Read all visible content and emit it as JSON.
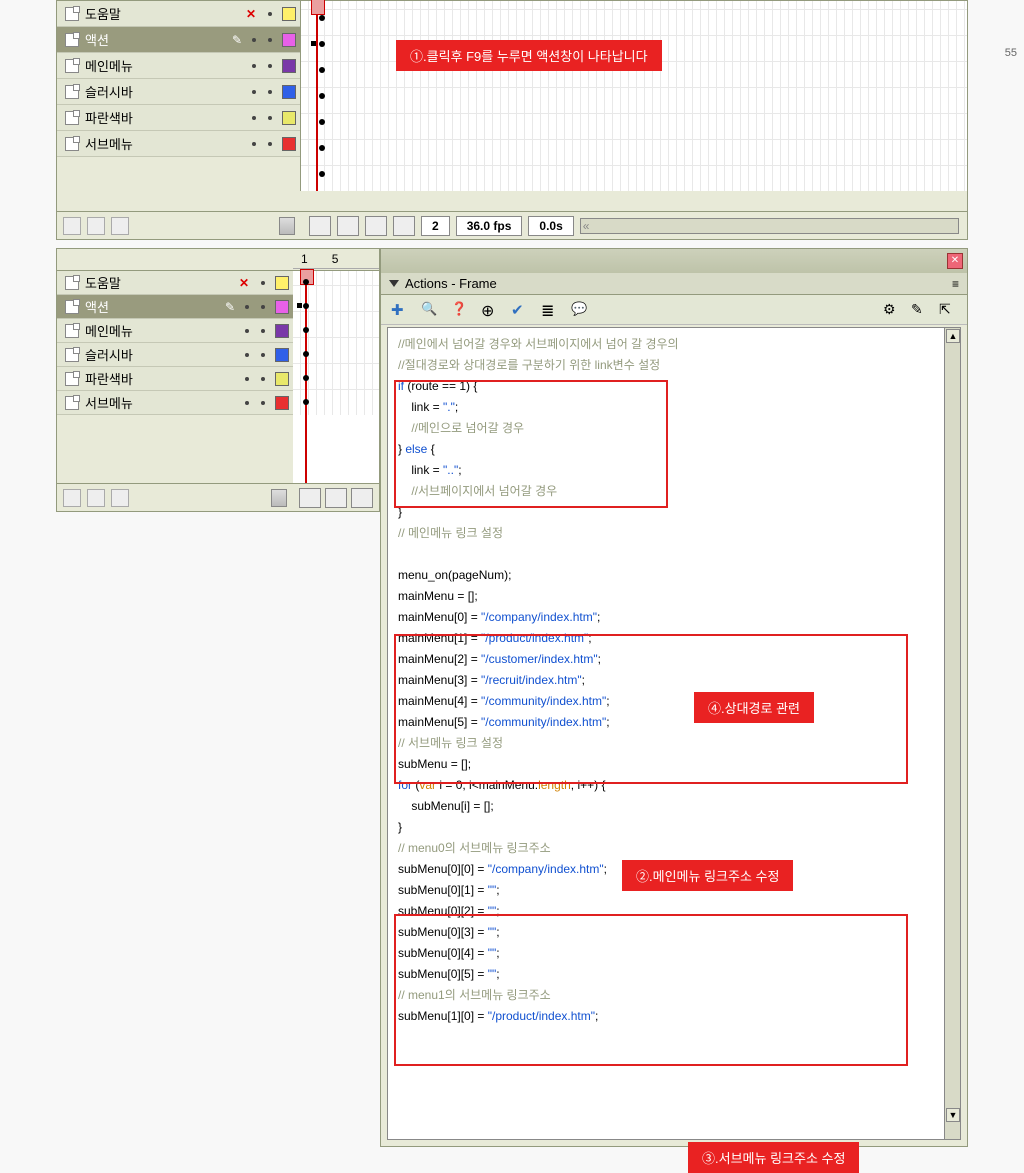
{
  "ruler": {
    "label55": "55"
  },
  "timeline1": {
    "layers": [
      {
        "name": "도움말",
        "color": "#fff06a"
      },
      {
        "name": "액션",
        "color": "#e860e8"
      },
      {
        "name": "메인메뉴",
        "color": "#7a38a8"
      },
      {
        "name": "슬러시바",
        "color": "#3060e8"
      },
      {
        "name": "파란색바",
        "color": "#e8e86a"
      },
      {
        "name": "서브메뉴",
        "color": "#e83030"
      }
    ],
    "footer": {
      "frame": "2",
      "fps": "36.0 fps",
      "time": "0.0s"
    }
  },
  "callouts": {
    "c1": "①.클릭후 F9를 누루면 액션창이 나타납니다",
    "c2": "④.상대경로 관련",
    "c3": "②.메인메뉴 링크주소 수정",
    "c4": "③.서브메뉴 링크주소 수정"
  },
  "timeline2": {
    "frameNums": {
      "n1": "1",
      "n5": "5"
    },
    "layers": [
      {
        "name": "도움말",
        "color": "#fff06a"
      },
      {
        "name": "액션",
        "color": "#e860e8"
      },
      {
        "name": "메인메뉴",
        "color": "#7a38a8"
      },
      {
        "name": "슬러시바",
        "color": "#3060e8"
      },
      {
        "name": "파란색바",
        "color": "#e8e86a"
      },
      {
        "name": "서브메뉴",
        "color": "#e83030"
      }
    ]
  },
  "actions": {
    "title": "Actions - Frame",
    "code": {
      "l1": "//메인에서 넘어갈 경우와 서브페이지에서 넘어 갈 경우의",
      "l2": "//절대경로와 상대경로를 구분하기 위한 link변수 설정",
      "l3a": "if",
      "l3b": " (route == 1) {",
      "l4a": "    link = ",
      "l4b": "\".\"",
      "l4c": ";",
      "l5": "    //메인으로 넘어갈 경우",
      "l6a": "} ",
      "l6b": "else",
      "l6c": " {",
      "l7a": "    link = ",
      "l7b": "\"..\"",
      "l7c": ";",
      "l8": "    //서브페이지에서 넘어갈 경우",
      "l9": "}",
      "l10": "// 메인메뉴 링크 설정",
      "l11": "",
      "l12": "menu_on(pageNum);",
      "l13": "mainMenu = [];",
      "l14a": "mainMenu[0] = ",
      "l14b": "\"/company/index.htm\"",
      "l14c": ";",
      "l15a": "mainMenu[1] = ",
      "l15b": "\"/product/index.htm\"",
      "l15c": ";",
      "l16a": "mainMenu[2] = ",
      "l16b": "\"/customer/index.htm\"",
      "l16c": ";",
      "l17a": "mainMenu[3] = ",
      "l17b": "\"/recruit/index.htm\"",
      "l17c": ";",
      "l18a": "mainMenu[4] = ",
      "l18b": "\"/community/index.htm\"",
      "l18c": ";",
      "l19a": "mainMenu[5] = ",
      "l19b": "\"/community/index.htm\"",
      "l19c": ";",
      "l20": "// 서브메뉴 링크 설정",
      "l21": "subMenu = [];",
      "l22a": "for",
      "l22b": " (",
      "l22c": "var",
      "l22d": " i = 0; i<mainMenu.",
      "l22e": "length",
      "l22f": "; i++) {",
      "l23": "    subMenu[i] = [];",
      "l24": "}",
      "l25": "// menu0의 서브메뉴 링크주소",
      "l26a": "subMenu[0][0] = ",
      "l26b": "\"/company/index.htm\"",
      "l26c": ";",
      "l27a": "subMenu[0][1] = ",
      "l27b": "\"\"",
      "l27c": ";",
      "l28a": "subMenu[0][2] = ",
      "l28b": "\"\"",
      "l28c": ";",
      "l29a": "subMenu[0][3] = ",
      "l29b": "\"\"",
      "l29c": ";",
      "l30a": "subMenu[0][4] = ",
      "l30b": "\"\"",
      "l30c": ";",
      "l31a": "subMenu[0][5] = ",
      "l31b": "\"\"",
      "l31c": ";",
      "l32": "// menu1의 서브메뉴 링크주소",
      "l33a": "subMenu[1][0] = ",
      "l33b": "\"/product/index.htm\"",
      "l33c": ";"
    }
  }
}
